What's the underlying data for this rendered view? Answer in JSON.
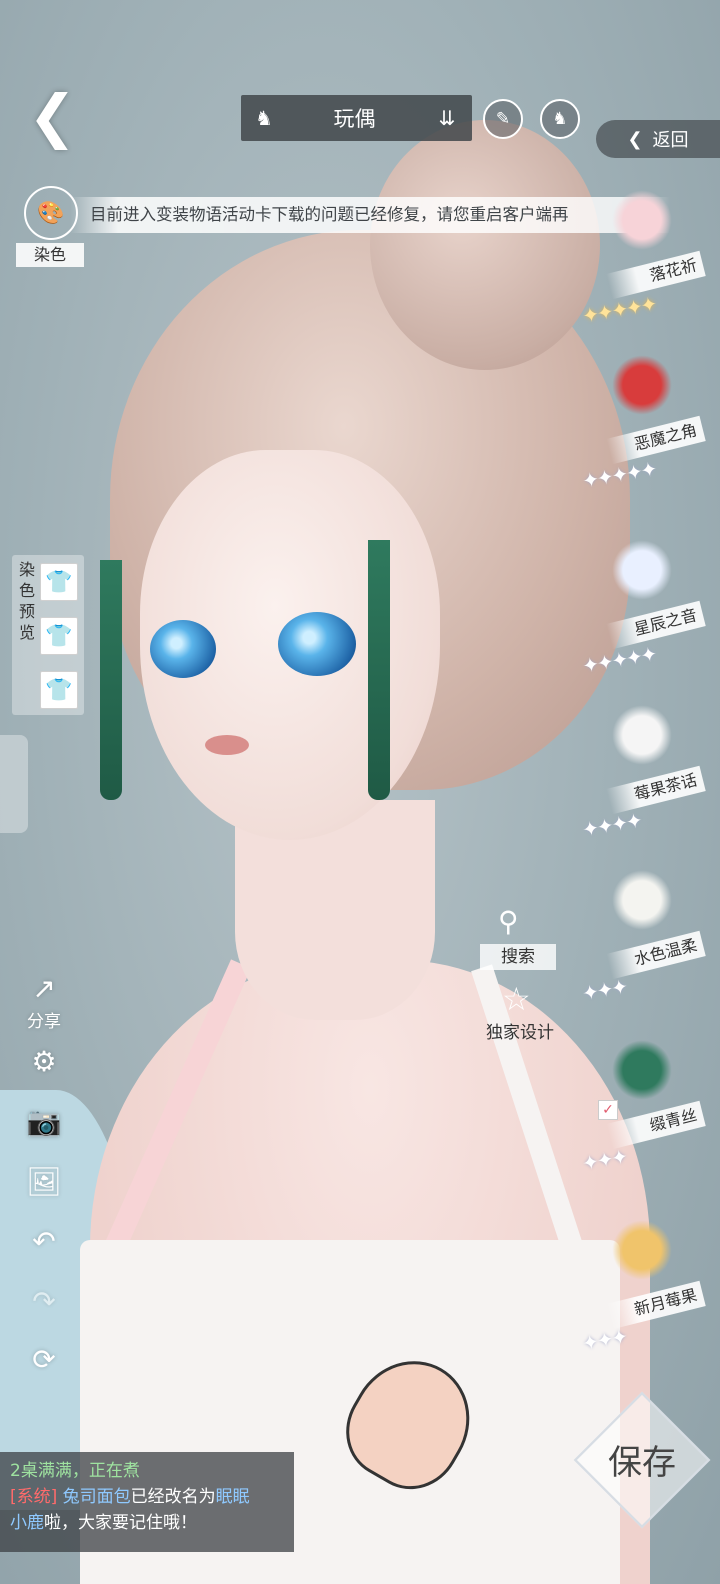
{
  "top_bar": {
    "category_icon": "dress-icon",
    "category_label": "玩偶",
    "dropdown_icon": "chevron-down-icon",
    "brush_icon": "brush-icon",
    "outfit_icon": "dress-icon"
  },
  "return_button": {
    "icon": "chevron-left-icon",
    "label": "返回"
  },
  "notice": {
    "text": "目前进入变装物语活动卡下载的问题已经修复，请您重启客户端再"
  },
  "dye": {
    "label": "染色"
  },
  "dye_preview": {
    "label": "染色预览"
  },
  "search": {
    "label": "搜索"
  },
  "design": {
    "label": "独家设计"
  },
  "left_tools": {
    "share_label": "分享"
  },
  "items": [
    {
      "name": "落花祈",
      "stars": 5,
      "gold": true,
      "selected": false
    },
    {
      "name": "恶魔之角",
      "stars": 5,
      "gold": false,
      "selected": false
    },
    {
      "name": "星辰之音",
      "stars": 5,
      "gold": false,
      "selected": false
    },
    {
      "name": "莓果茶话",
      "stars": 4,
      "gold": false,
      "selected": false
    },
    {
      "name": "水色温柔",
      "stars": 3,
      "gold": false,
      "selected": false
    },
    {
      "name": "缀青丝",
      "stars": 3,
      "gold": false,
      "selected": true
    },
    {
      "name": "新月莓果",
      "stars": 3,
      "gold": false,
      "selected": false
    }
  ],
  "chat": {
    "line1": "2桌满满，正在煮",
    "sys_tag": "[系统]",
    "name_a": "兔司面包",
    "mid": "已经改名为",
    "name_b_1": "眠眠",
    "name_b_2": "小鹿",
    "tail": "啦，大家要记住哦！"
  },
  "save": {
    "label": "保存"
  }
}
